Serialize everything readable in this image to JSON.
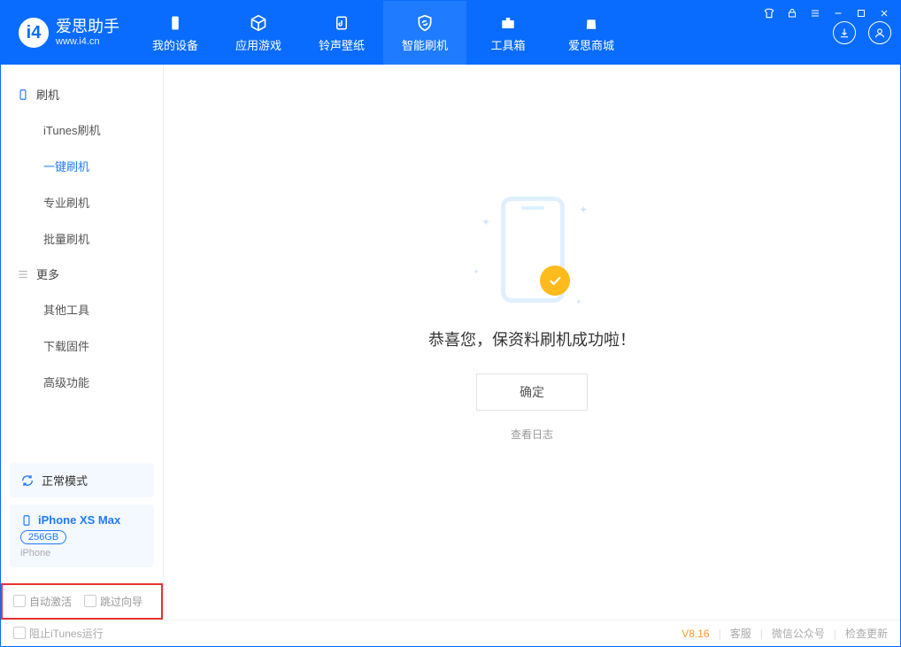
{
  "app": {
    "name": "爱思助手",
    "url": "www.i4.cn"
  },
  "header_tabs": [
    {
      "label": "我的设备"
    },
    {
      "label": "应用游戏"
    },
    {
      "label": "铃声壁纸"
    },
    {
      "label": "智能刷机"
    },
    {
      "label": "工具箱"
    },
    {
      "label": "爱思商城"
    }
  ],
  "sidebar": {
    "group1_title": "刷机",
    "group1_items": [
      "iTunes刷机",
      "一键刷机",
      "专业刷机",
      "批量刷机"
    ],
    "group2_title": "更多",
    "group2_items": [
      "其他工具",
      "下载固件",
      "高级功能"
    ]
  },
  "mode": "正常模式",
  "device": {
    "name": "iPhone XS Max",
    "storage": "256GB",
    "type": "iPhone"
  },
  "options": {
    "auto_activate": "自动激活",
    "skip_wizard": "跳过向导"
  },
  "main": {
    "success_text": "恭喜您，保资料刷机成功啦！",
    "ok": "确定",
    "view_log": "查看日志"
  },
  "footer": {
    "block_itunes": "阻止iTunes运行",
    "version": "V8.16",
    "service": "客服",
    "wechat": "微信公众号",
    "update": "检查更新"
  },
  "colors": {
    "brand": "#0a6cff",
    "accent": "#1f7bff",
    "warn": "#ff9a2e"
  }
}
